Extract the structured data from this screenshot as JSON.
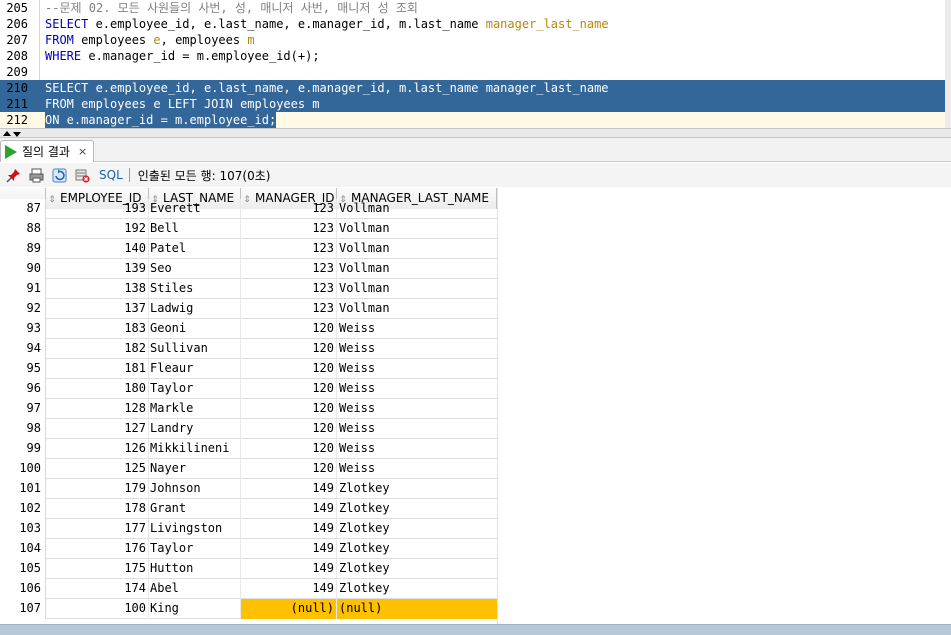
{
  "editor": {
    "lines": [
      {
        "num": "205",
        "segments": [
          {
            "t": "--문제 02. 모든 사원들의 사번, 성, 매니저 사번, 매니저 성 조회",
            "c": "cm"
          }
        ]
      },
      {
        "num": "206",
        "segments": [
          {
            "t": "SELECT",
            "c": "kw"
          },
          {
            "t": " e.employee_id, e.last_name, e.manager_id, m.last_name ",
            "c": ""
          },
          {
            "t": "manager_last_name",
            "c": "al"
          }
        ]
      },
      {
        "num": "207",
        "segments": [
          {
            "t": "FROM",
            "c": "kw"
          },
          {
            "t": " employees ",
            "c": ""
          },
          {
            "t": "e",
            "c": "al"
          },
          {
            "t": ", employees ",
            "c": ""
          },
          {
            "t": "m",
            "c": "al"
          }
        ]
      },
      {
        "num": "208",
        "segments": [
          {
            "t": "WHERE",
            "c": "kw"
          },
          {
            "t": " e.manager_id = m.employee_id(+);",
            "c": ""
          }
        ]
      },
      {
        "num": "209",
        "segments": [
          {
            "t": "",
            "c": ""
          }
        ]
      },
      {
        "num": "210",
        "selected": true,
        "segments": [
          {
            "t": "SELECT e.employee_id, e.last_name, e.manager_id, m.last_name manager_last_name",
            "c": ""
          }
        ]
      },
      {
        "num": "211",
        "selected": true,
        "segments": [
          {
            "t": "FROM employees e LEFT JOIN employees m",
            "c": ""
          }
        ]
      },
      {
        "num": "212",
        "current": true,
        "segments": [
          {
            "t": "ON e.manager_id = m.employee_id;",
            "c": ""
          }
        ]
      }
    ]
  },
  "results_tab": {
    "label": "질의 결과",
    "close": "×"
  },
  "toolbar": {
    "icons": [
      "pin-icon",
      "print-icon",
      "refresh-icon",
      "cancel-icon"
    ],
    "sql_label": "SQL",
    "status": "인출된 모든 행: 107(0초)"
  },
  "grid": {
    "columns": [
      "EMPLOYEE_ID",
      "LAST_NAME",
      "MANAGER_ID",
      "MANAGER_LAST_NAME"
    ],
    "partial_row": {
      "num": "87",
      "employee_id": "193",
      "last_name": "Everett",
      "manager_id": "123",
      "manager_last_name": "Vollman"
    },
    "rows": [
      {
        "num": "88",
        "employee_id": "192",
        "last_name": "Bell",
        "manager_id": "123",
        "manager_last_name": "Vollman"
      },
      {
        "num": "89",
        "employee_id": "140",
        "last_name": "Patel",
        "manager_id": "123",
        "manager_last_name": "Vollman"
      },
      {
        "num": "90",
        "employee_id": "139",
        "last_name": "Seo",
        "manager_id": "123",
        "manager_last_name": "Vollman"
      },
      {
        "num": "91",
        "employee_id": "138",
        "last_name": "Stiles",
        "manager_id": "123",
        "manager_last_name": "Vollman"
      },
      {
        "num": "92",
        "employee_id": "137",
        "last_name": "Ladwig",
        "manager_id": "123",
        "manager_last_name": "Vollman"
      },
      {
        "num": "93",
        "employee_id": "183",
        "last_name": "Geoni",
        "manager_id": "120",
        "manager_last_name": "Weiss"
      },
      {
        "num": "94",
        "employee_id": "182",
        "last_name": "Sullivan",
        "manager_id": "120",
        "manager_last_name": "Weiss"
      },
      {
        "num": "95",
        "employee_id": "181",
        "last_name": "Fleaur",
        "manager_id": "120",
        "manager_last_name": "Weiss"
      },
      {
        "num": "96",
        "employee_id": "180",
        "last_name": "Taylor",
        "manager_id": "120",
        "manager_last_name": "Weiss"
      },
      {
        "num": "97",
        "employee_id": "128",
        "last_name": "Markle",
        "manager_id": "120",
        "manager_last_name": "Weiss"
      },
      {
        "num": "98",
        "employee_id": "127",
        "last_name": "Landry",
        "manager_id": "120",
        "manager_last_name": "Weiss"
      },
      {
        "num": "99",
        "employee_id": "126",
        "last_name": "Mikkilineni",
        "manager_id": "120",
        "manager_last_name": "Weiss"
      },
      {
        "num": "100",
        "employee_id": "125",
        "last_name": "Nayer",
        "manager_id": "120",
        "manager_last_name": "Weiss"
      },
      {
        "num": "101",
        "employee_id": "179",
        "last_name": "Johnson",
        "manager_id": "149",
        "manager_last_name": "Zlotkey"
      },
      {
        "num": "102",
        "employee_id": "178",
        "last_name": "Grant",
        "manager_id": "149",
        "manager_last_name": "Zlotkey"
      },
      {
        "num": "103",
        "employee_id": "177",
        "last_name": "Livingston",
        "manager_id": "149",
        "manager_last_name": "Zlotkey"
      },
      {
        "num": "104",
        "employee_id": "176",
        "last_name": "Taylor",
        "manager_id": "149",
        "manager_last_name": "Zlotkey"
      },
      {
        "num": "105",
        "employee_id": "175",
        "last_name": "Hutton",
        "manager_id": "149",
        "manager_last_name": "Zlotkey"
      },
      {
        "num": "106",
        "employee_id": "174",
        "last_name": "Abel",
        "manager_id": "149",
        "manager_last_name": "Zlotkey"
      },
      {
        "num": "107",
        "employee_id": "100",
        "last_name": "King",
        "manager_id": "(null)",
        "manager_last_name": "(null)",
        "null_highlight": true
      }
    ]
  },
  "colors": {
    "selection": "#336699",
    "keyword": "#0000c0",
    "alias": "#b8860b",
    "null_cell": "#ffc000",
    "run_icon": "#2aa52a"
  }
}
